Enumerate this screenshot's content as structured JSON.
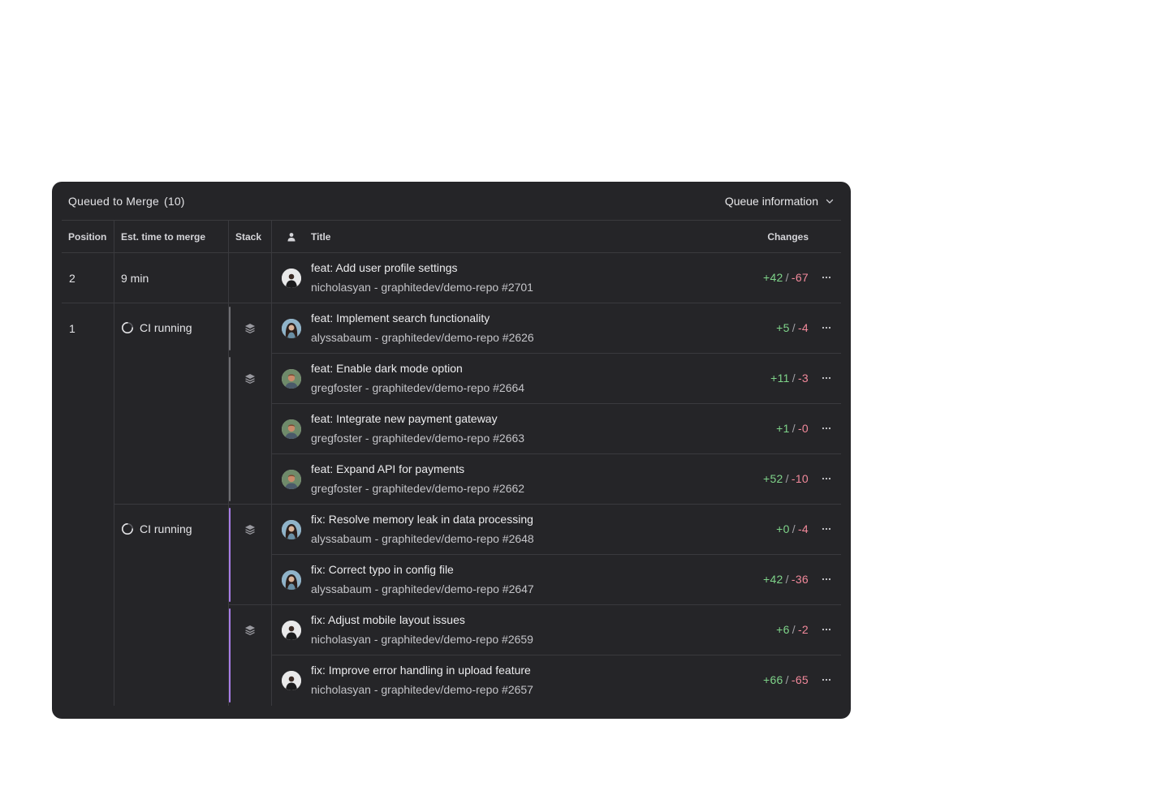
{
  "header": {
    "title": "Queued to Merge",
    "count": "(10)",
    "queue_info_label": "Queue information"
  },
  "columns": {
    "position": "Position",
    "est_time": "Est. time to merge",
    "stack": "Stack",
    "title": "Title",
    "changes": "Changes"
  },
  "groups": [
    {
      "position": "2",
      "est": "9 min"
    },
    {
      "position": "1",
      "est_a": "CI running",
      "est_b": "CI running"
    }
  ],
  "rows": [
    {
      "title": "feat: Add user profile settings",
      "sub": "nicholasyan - graphitedev/demo-repo #2701",
      "add": "+42",
      "del": "-67",
      "avatar": "nicholasyan"
    },
    {
      "title": "feat: Implement search functionality",
      "sub": "alyssabaum - graphitedev/demo-repo #2626",
      "add": "+5",
      "del": "-4",
      "avatar": "alyssabaum"
    },
    {
      "title": "feat: Enable dark mode option",
      "sub": "gregfoster - graphitedev/demo-repo #2664",
      "add": "+11",
      "del": "-3",
      "avatar": "gregfoster"
    },
    {
      "title": "feat: Integrate new payment gateway",
      "sub": "gregfoster - graphitedev/demo-repo #2663",
      "add": "+1",
      "del": "-0",
      "avatar": "gregfoster"
    },
    {
      "title": "feat: Expand API for payments",
      "sub": "gregfoster - graphitedev/demo-repo #2662",
      "add": "+52",
      "del": "-10",
      "avatar": "gregfoster"
    },
    {
      "title": "fix: Resolve memory leak in data processing",
      "sub": "alyssabaum - graphitedev/demo-repo #2648",
      "add": "+0",
      "del": "-4",
      "avatar": "alyssabaum"
    },
    {
      "title": "fix: Correct typo in config file",
      "sub": "alyssabaum - graphitedev/demo-repo #2647",
      "add": "+42",
      "del": "-36",
      "avatar": "alyssabaum"
    },
    {
      "title": "fix: Adjust mobile layout issues",
      "sub": "nicholasyan - graphitedev/demo-repo #2659",
      "add": "+6",
      "del": "-2",
      "avatar": "nicholasyan"
    },
    {
      "title": "fix: Improve error handling in upload feature",
      "sub": "nicholasyan - graphitedev/demo-repo #2657",
      "add": "+66",
      "del": "-65",
      "avatar": "nicholasyan"
    }
  ],
  "colors": {
    "panel": "#252528",
    "add": "#7fd48a",
    "del": "#f2899b",
    "stack_gray": "#6e6e73",
    "stack_purple": "#a77de6"
  }
}
